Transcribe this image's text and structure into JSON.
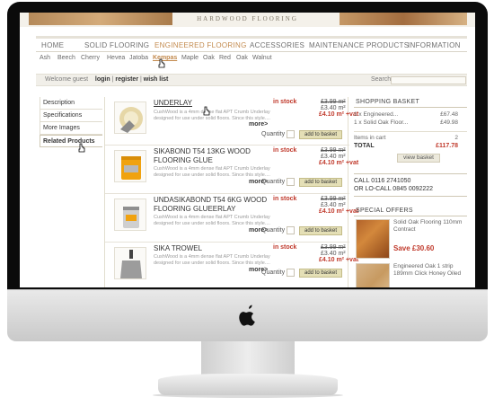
{
  "site": {
    "banner_title": "HARDWOOD FLOORING"
  },
  "nav": {
    "items": [
      "HOME",
      "SOLID FLOORING",
      "ENGINEERED FLOORING",
      "ACCESSORIES",
      "MAINTENANCE PRODUCTS",
      "INFORMATION"
    ],
    "active": "ENGINEERED FLOORING"
  },
  "subnav": {
    "items": [
      "Ash",
      "Beech",
      "Cherry",
      "Hevea",
      "Jatoba",
      "Kempas",
      "Maple",
      "Oak",
      "Red",
      "Oak",
      "Walnut"
    ],
    "selected": "Kempas"
  },
  "user_bar": {
    "welcome": "Welcome guest",
    "login": "login",
    "register": "register",
    "wishlist": "wish list",
    "search_label": "Search"
  },
  "tabs": [
    "Description",
    "Specifications",
    "More Images",
    "Related Products"
  ],
  "products": [
    {
      "name": "UNDERLAY",
      "desc": "CushWood is a 4mm dense flat APT Crumb Underlay designed for use under solid floors. Since this style....",
      "more": "more>",
      "stock": "in stock",
      "price_old": "£3.99 m²",
      "price_m2": "£3.40 m²",
      "price_vat": "£4.10 m² +vat",
      "qty_label": "Quantity",
      "button": "add to basket"
    },
    {
      "name": "SIKABOND T54 13KG WOOD FLOORING GLUE",
      "desc": "CushWood is a 4mm dense flat APT Crumb Underlay designed for use under solid floors. Since this style....",
      "more": "more>",
      "stock": "in stock",
      "price_old": "£3.99 m²",
      "price_m2": "£3.40 m²",
      "price_vat": "£4.10 m² +vat",
      "qty_label": "Quantity",
      "button": "add to basket"
    },
    {
      "name": "UNDASIKABOND T54 6KG WOOD FLOORING GLUEERLAY",
      "desc": "CushWood is a 4mm dense flat APT Crumb Underlay designed for use under solid floors. Since this style....",
      "more": "more>",
      "stock": "in stock",
      "price_old": "£3.99 m²",
      "price_m2": "£3.40 m²",
      "price_vat": "£4.10 m² +vat",
      "qty_label": "Quantity",
      "button": "add to basket"
    },
    {
      "name": "SIKA TROWEL",
      "desc": "CushWood is a 4mm dense flat APT Crumb Underlay designed for use under solid floors. Since this style....",
      "more": "more>",
      "stock": "in stock",
      "price_old": "£3.99 m²",
      "price_m2": "£3.40 m²",
      "price_vat": "£4.10 m² +vat",
      "qty_label": "Quantity",
      "button": "add to basket"
    }
  ],
  "basket": {
    "title": "SHOPPING BASKET",
    "lines": [
      {
        "label": "1 x Engineered...",
        "price": "£67.48"
      },
      {
        "label": "1 x Solid Oak Floor...",
        "price": "£49.98"
      }
    ],
    "items_label": "Items in cart",
    "items_count": "2",
    "total_label": "TOTAL",
    "total": "£117.78",
    "button": "view basket"
  },
  "contact": {
    "line1": "CALL 0116 2741050",
    "line2": "OR LO-CALL 0845 0092222"
  },
  "offers": {
    "title": "SPECIAL OFFERS",
    "items": [
      {
        "name": "Solid Oak Flooring 110mm Contract",
        "save": "Save £30.60"
      },
      {
        "name": "Engineered Oak 1 strip 189mm Click Honey Oiled",
        "save": ""
      }
    ]
  },
  "colors": {
    "accent": "#c38a4d",
    "price_red": "#c0392b",
    "button_bg": "#e4dfb6"
  }
}
